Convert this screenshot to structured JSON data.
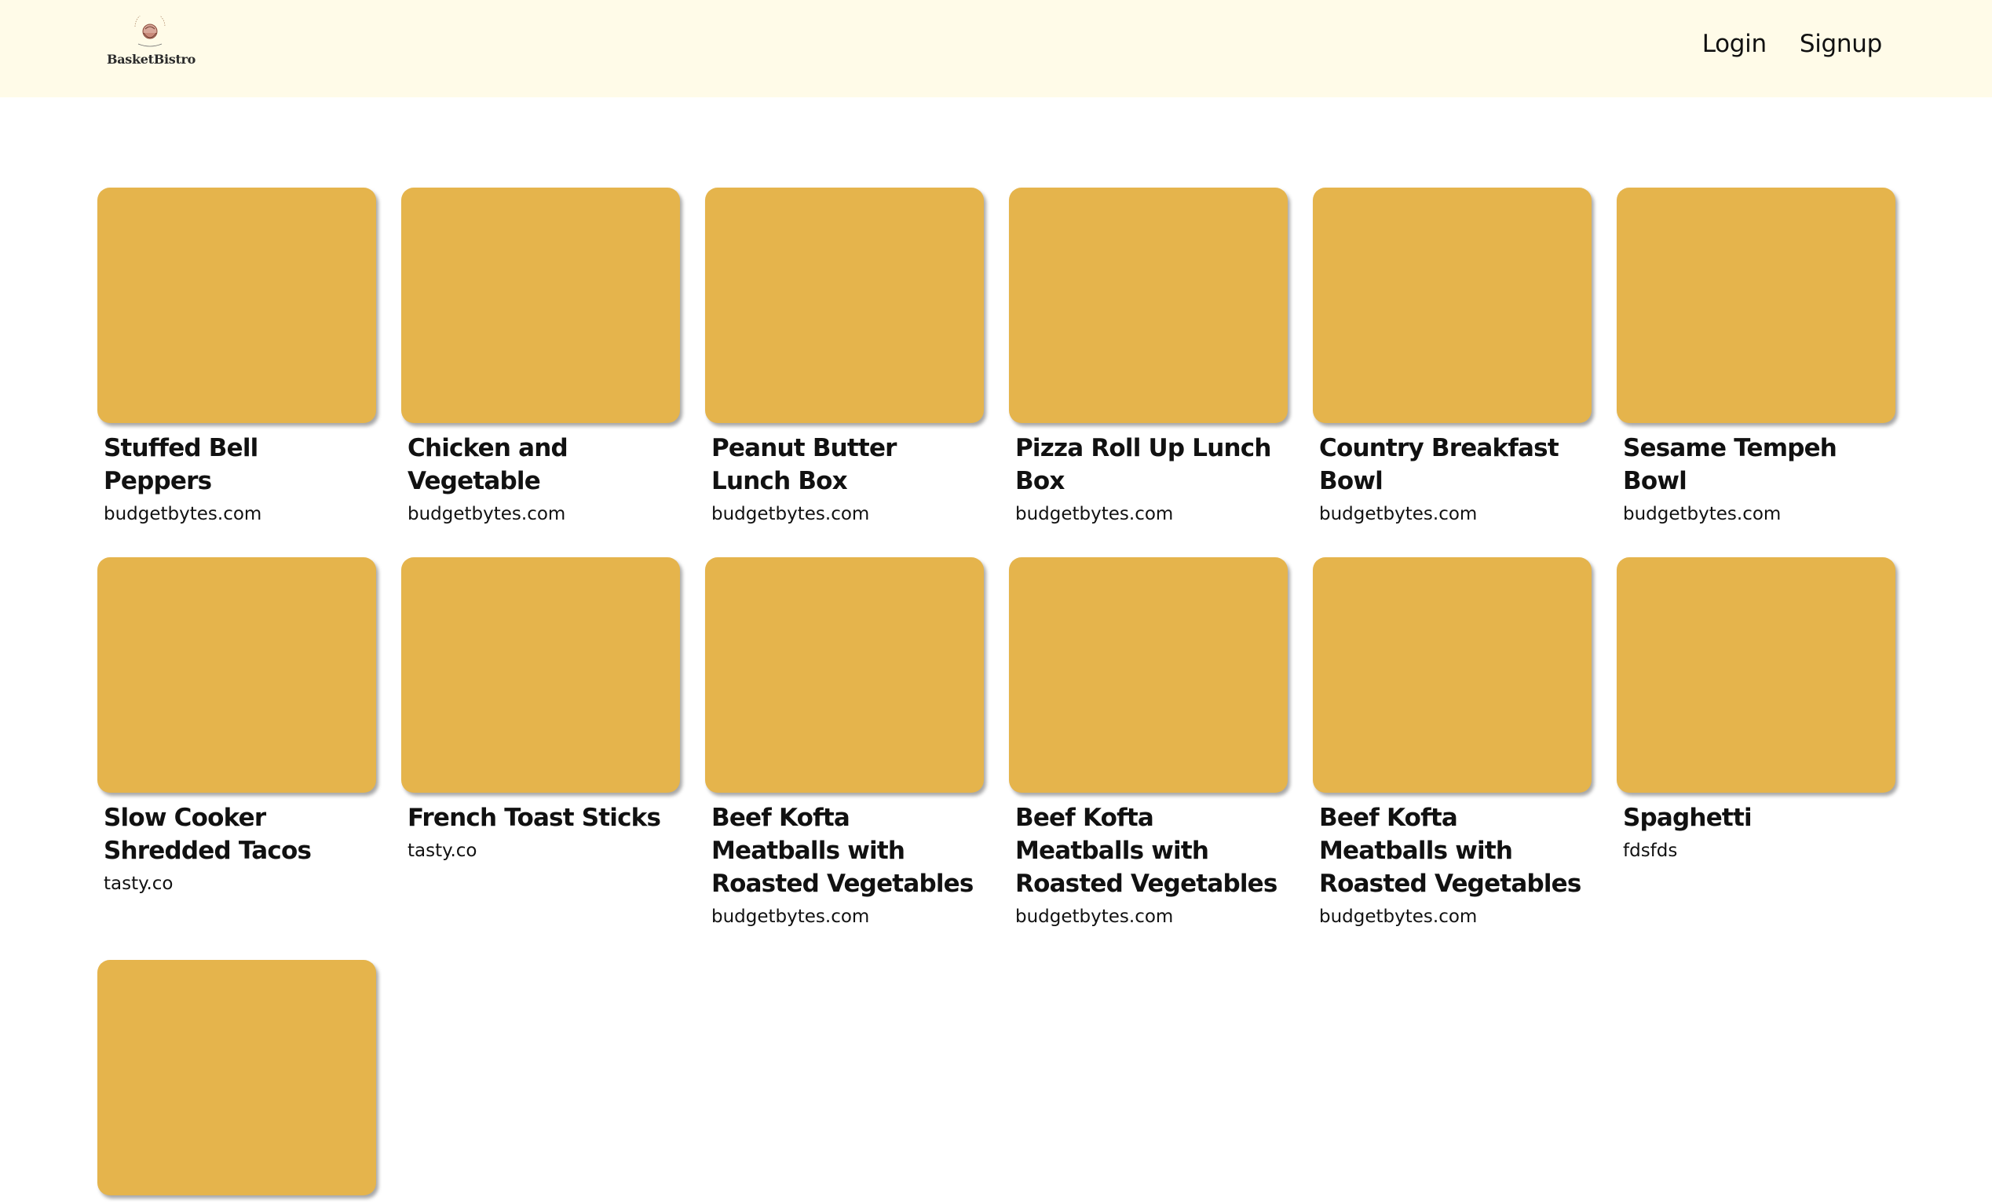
{
  "header": {
    "logo_text": "BasketBistro",
    "nav": {
      "login_label": "Login",
      "signup_label": "Signup"
    }
  },
  "recipes": [
    {
      "title": "Stuffed Bell Peppers",
      "source": "budgetbytes.com"
    },
    {
      "title": "Chicken and Vegetable",
      "source": "budgetbytes.com"
    },
    {
      "title": "Peanut Butter Lunch Box",
      "source": "budgetbytes.com"
    },
    {
      "title": "Pizza Roll Up Lunch Box",
      "source": "budgetbytes.com"
    },
    {
      "title": "Country Breakfast Bowl",
      "source": "budgetbytes.com"
    },
    {
      "title": "Sesame Tempeh Bowl",
      "source": "budgetbytes.com"
    },
    {
      "title": "Slow Cooker Shredded Tacos",
      "source": "tasty.co"
    },
    {
      "title": "French Toast Sticks",
      "source": "tasty.co"
    },
    {
      "title": "Beef Kofta Meatballs with Roasted Vegetables",
      "source": "budgetbytes.com"
    },
    {
      "title": "Beef Kofta Meatballs with Roasted Vegetables",
      "source": "budgetbytes.com"
    },
    {
      "title": "Beef Kofta Meatballs with Roasted Vegetables",
      "source": "budgetbytes.com"
    },
    {
      "title": "Spaghetti",
      "source": "fdsfds"
    },
    {
      "title": "",
      "source": ""
    }
  ],
  "colors": {
    "header_bg": "#fffbe8",
    "card_image": "#e5b44c"
  }
}
